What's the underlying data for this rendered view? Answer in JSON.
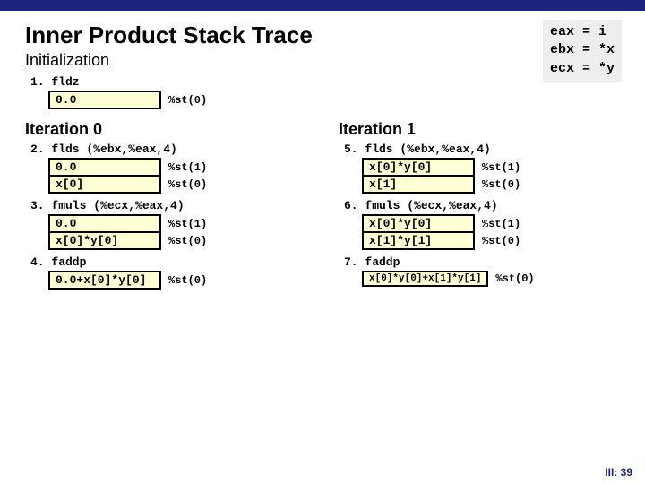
{
  "title": "Inner Product Stack Trace",
  "subtitle": "Initialization",
  "regs": "eax = i\nebx = *x\necx = *y",
  "init": {
    "step": "1. fldz",
    "rows": [
      {
        "v": "0.0",
        "l": "%st(0)"
      }
    ]
  },
  "iter0": {
    "heading": "Iteration 0",
    "b1": {
      "step": "2. flds (%ebx,%eax,4)",
      "rows": [
        {
          "v": "0.0",
          "l": "%st(1)"
        },
        {
          "v": "x[0]",
          "l": "%st(0)"
        }
      ]
    },
    "b2": {
      "step": "3. fmuls (%ecx,%eax,4)",
      "rows": [
        {
          "v": "0.0",
          "l": "%st(1)"
        },
        {
          "v": "x[0]*y[0]",
          "l": "%st(0)"
        }
      ]
    },
    "b3": {
      "step": "4. faddp",
      "rows": [
        {
          "v": "0.0+x[0]*y[0]",
          "l": "%st(0)"
        }
      ]
    }
  },
  "iter1": {
    "heading": "Iteration 1",
    "b1": {
      "step": "5. flds (%ebx,%eax,4)",
      "rows": [
        {
          "v": "x[0]*y[0]",
          "l": "%st(1)"
        },
        {
          "v": "x[1]",
          "l": "%st(0)"
        }
      ]
    },
    "b2": {
      "step": "6. fmuls (%ecx,%eax,4)",
      "rows": [
        {
          "v": "x[0]*y[0]",
          "l": "%st(1)"
        },
        {
          "v": "x[1]*y[1]",
          "l": "%st(0)"
        }
      ]
    },
    "b3": {
      "step": "7. faddp",
      "rows": [
        {
          "v": "x[0]*y[0]+x[1]*y[1]",
          "l": "%st(0)"
        }
      ]
    }
  },
  "pagenum": "III: 39"
}
